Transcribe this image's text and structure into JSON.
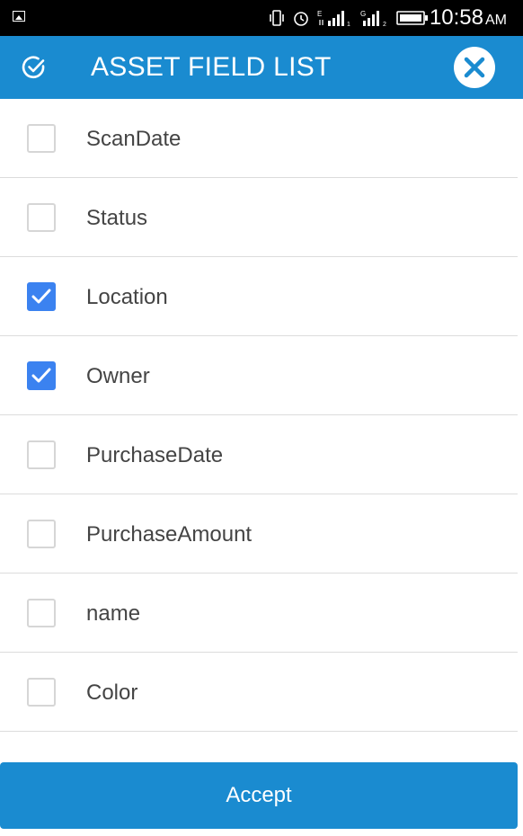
{
  "status_bar": {
    "time": "10:58",
    "ampm": "AM"
  },
  "header": {
    "title": "ASSET FIELD LIST"
  },
  "fields": [
    {
      "label": "ScanDate",
      "checked": false
    },
    {
      "label": "Status",
      "checked": false
    },
    {
      "label": "Location",
      "checked": true
    },
    {
      "label": "Owner",
      "checked": true
    },
    {
      "label": "PurchaseDate",
      "checked": false
    },
    {
      "label": "PurchaseAmount",
      "checked": false
    },
    {
      "label": "name",
      "checked": false
    },
    {
      "label": "Color",
      "checked": false
    }
  ],
  "footer": {
    "accept_label": "Accept"
  },
  "colors": {
    "appbar": "#1a8bd0",
    "checkbox_checked": "#3b82f0"
  },
  "icons": {
    "header_left": "check-circle-icon",
    "header_right": "close-icon"
  }
}
